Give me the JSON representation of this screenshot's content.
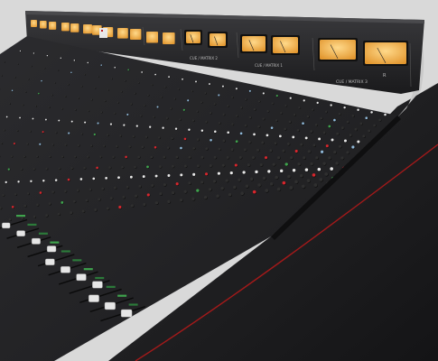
{
  "scene": {
    "subject": "studio-mixing-console",
    "background_color": "#d9d9d9",
    "chassis_color": "#1b1b1d",
    "meter_face_color": "#f0b24a",
    "knob_accent_colors": [
      "#d7262d",
      "#e8e8e8",
      "#8fb8d8",
      "#3fa34d",
      "#2f2f2f"
    ],
    "trim_line_color": "#b11a1a"
  },
  "meter_bridge": {
    "labels": [
      "CUE / MATRIX 1",
      "CUE / MATRIX 2",
      "CUE / MATRIX 3"
    ],
    "right_marker": "R"
  }
}
